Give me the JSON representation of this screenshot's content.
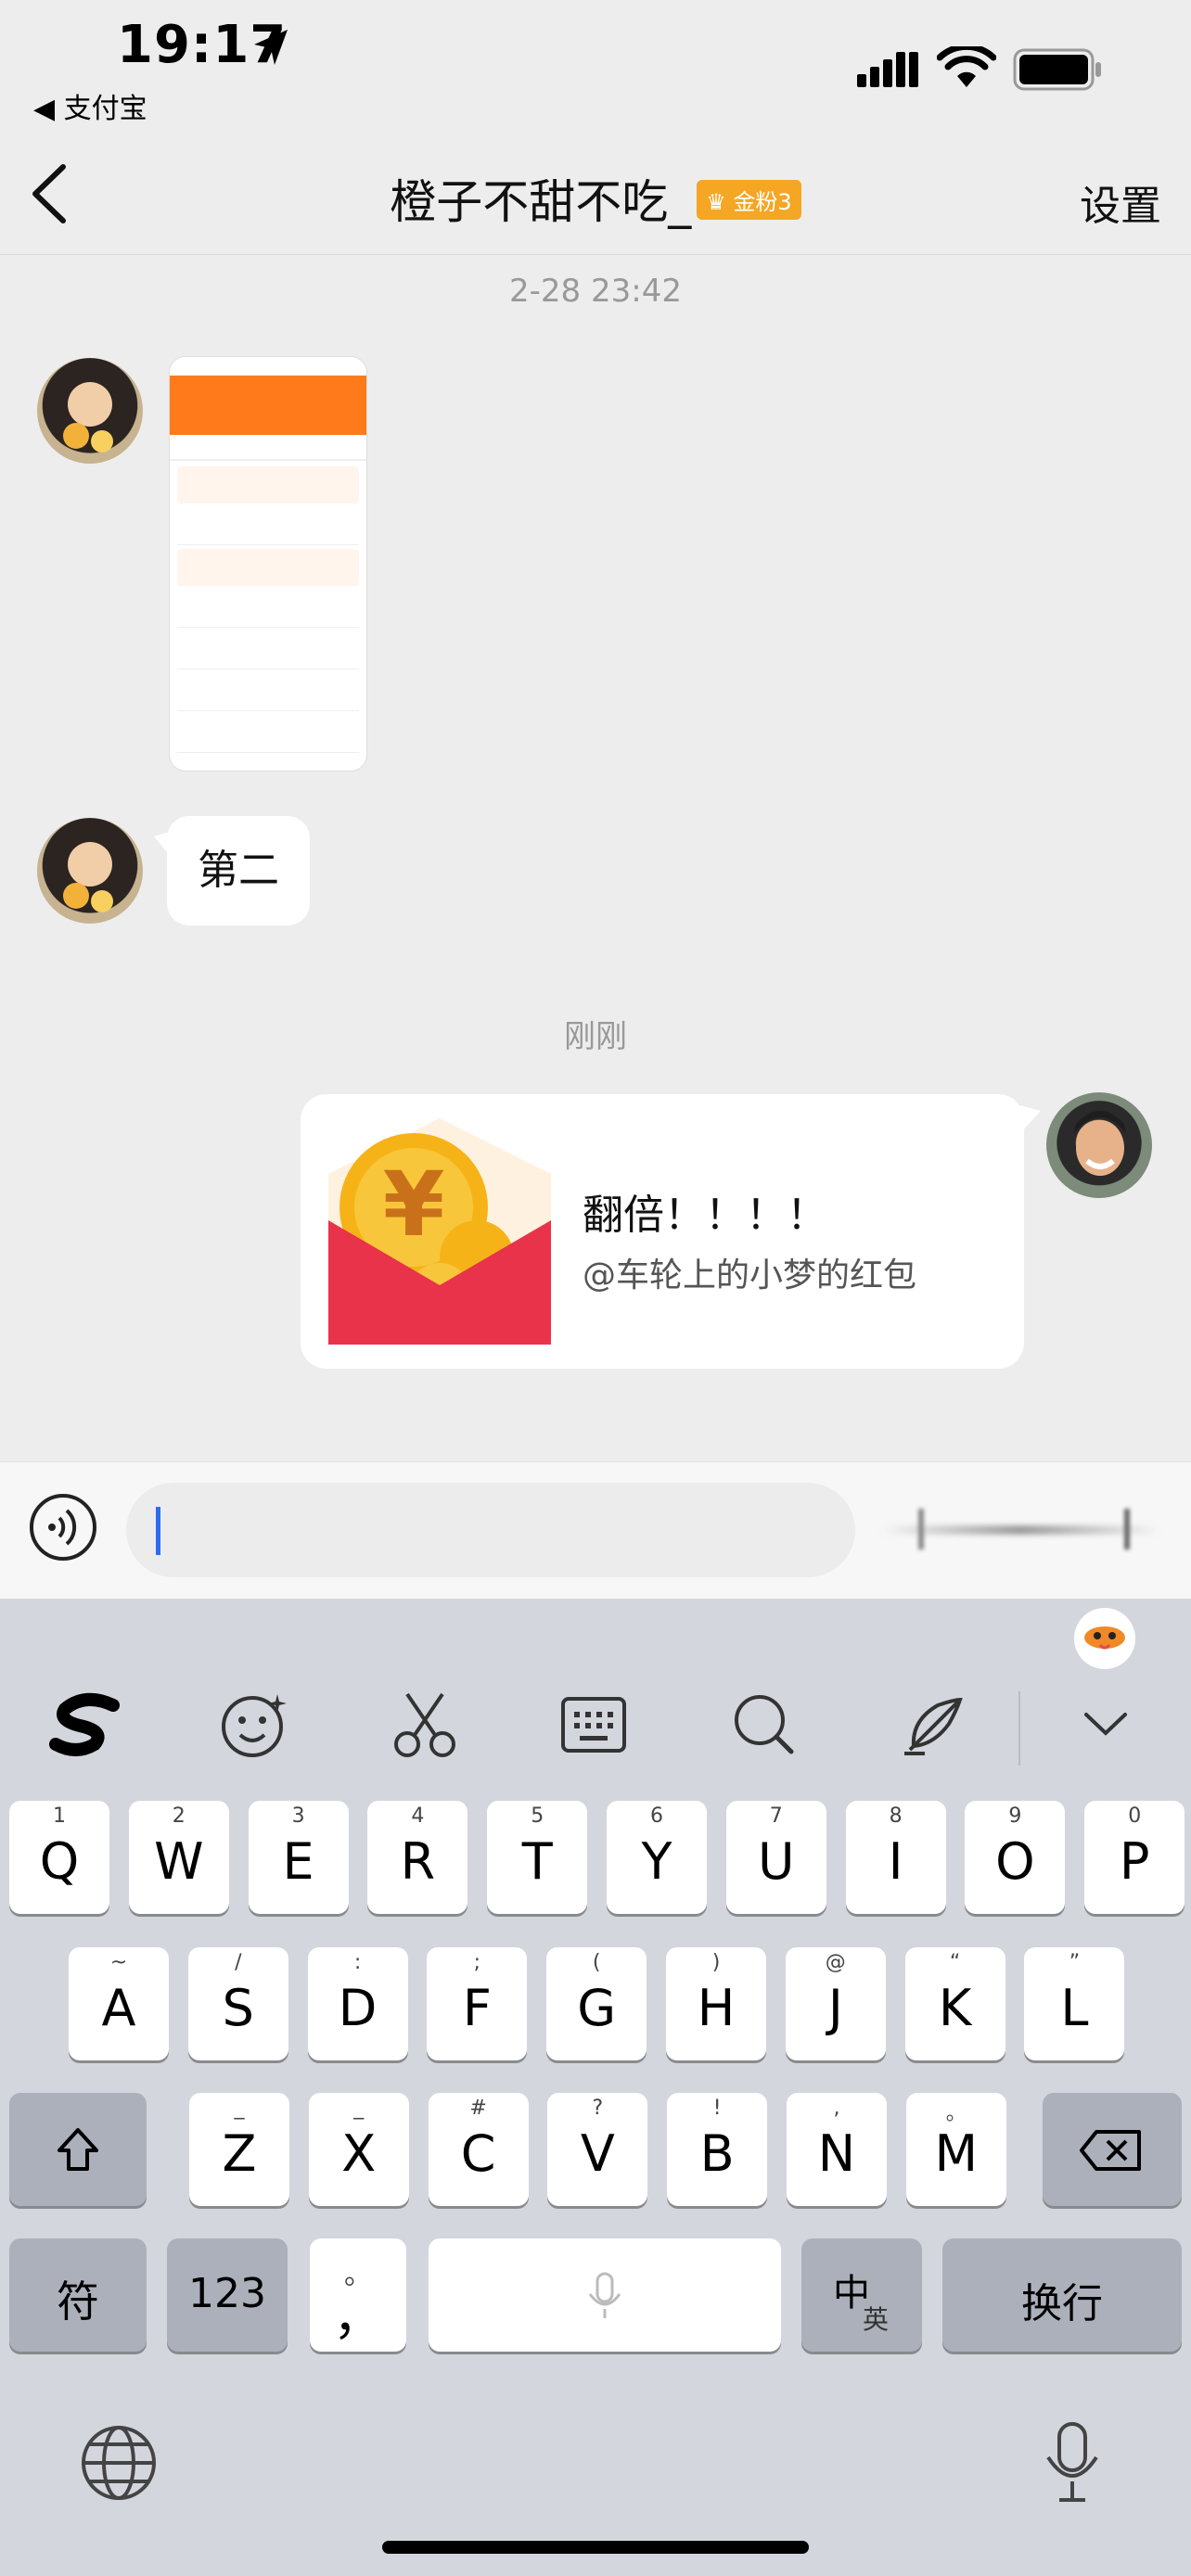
{
  "status_bar": {
    "time": "19:17",
    "back_app": "◀ 支付宝"
  },
  "nav": {
    "title": "橙子不甜不吃_",
    "badge": "金粉3",
    "settings": "设置"
  },
  "chat": {
    "timestamp1": "2-28 23:42",
    "message_text": "第二",
    "timestamp2": "刚刚",
    "red_packet": {
      "title": "翻倍！！！！",
      "subtitle": "@车轮上的小梦的红包",
      "color": "#e8334a"
    }
  },
  "input": {
    "value": ""
  },
  "keyboard": {
    "row1": [
      {
        "hint": "1",
        "key": "Q"
      },
      {
        "hint": "2",
        "key": "W"
      },
      {
        "hint": "3",
        "key": "E"
      },
      {
        "hint": "4",
        "key": "R"
      },
      {
        "hint": "5",
        "key": "T"
      },
      {
        "hint": "6",
        "key": "Y"
      },
      {
        "hint": "7",
        "key": "U"
      },
      {
        "hint": "8",
        "key": "I"
      },
      {
        "hint": "9",
        "key": "O"
      },
      {
        "hint": "0",
        "key": "P"
      }
    ],
    "row2": [
      {
        "hint": "~",
        "key": "A"
      },
      {
        "hint": "/",
        "key": "S"
      },
      {
        "hint": ":",
        "key": "D"
      },
      {
        "hint": ";",
        "key": "F"
      },
      {
        "hint": "(",
        "key": "G"
      },
      {
        "hint": ")",
        "key": "H"
      },
      {
        "hint": "@",
        "key": "J"
      },
      {
        "hint": "“",
        "key": "K"
      },
      {
        "hint": "”",
        "key": "L"
      }
    ],
    "row3": [
      {
        "hint": "_",
        "key": "Z"
      },
      {
        "hint": "_",
        "key": "X"
      },
      {
        "hint": "#",
        "key": "C"
      },
      {
        "hint": "?",
        "key": "V"
      },
      {
        "hint": "!",
        "key": "B"
      },
      {
        "hint": ",",
        "key": "N"
      },
      {
        "hint": "。",
        "key": "M"
      }
    ],
    "symbols_key": "符",
    "numbers_key": "123",
    "comma_key": "，",
    "comma_hint": "。",
    "lang_key_main": "中",
    "lang_key_sub": "英",
    "return_key": "换行"
  }
}
